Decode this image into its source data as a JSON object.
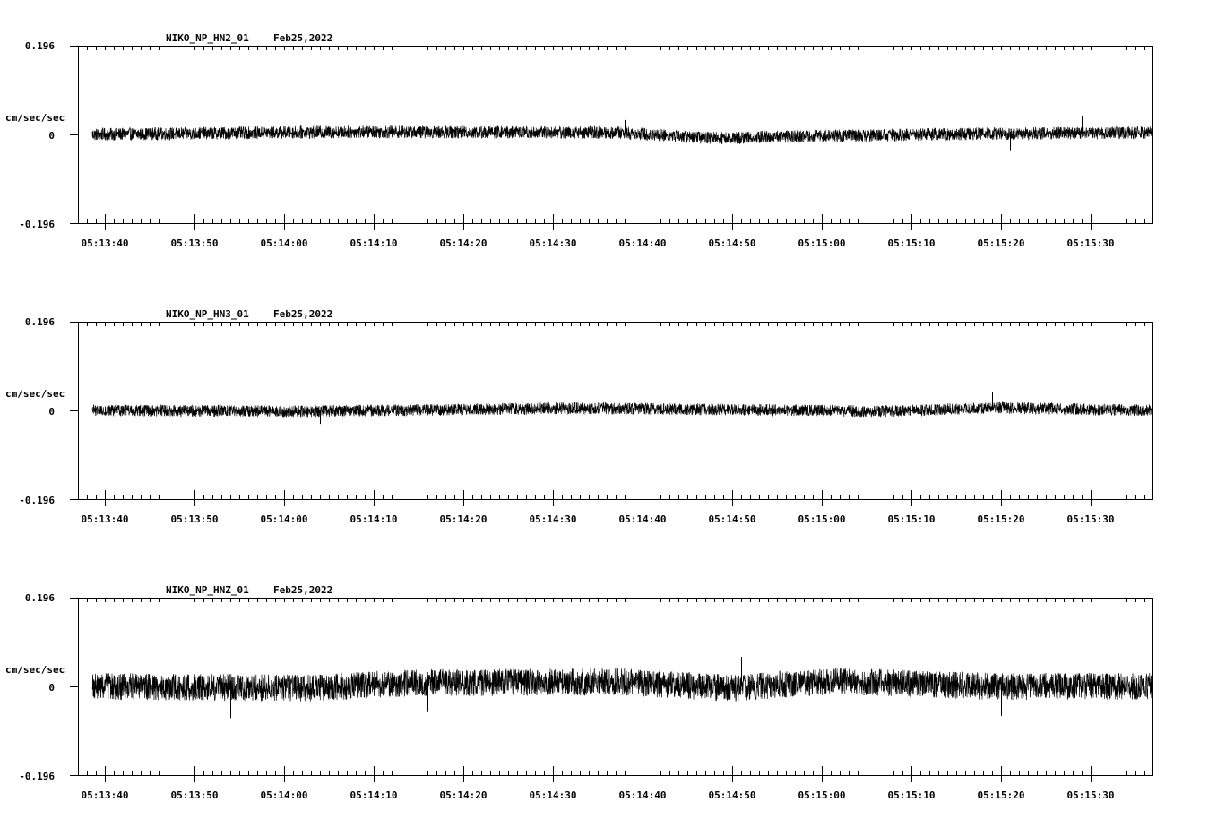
{
  "chart_data": [
    {
      "type": "line",
      "title": "NIKO_NP_HN2_01",
      "date": "Feb25,2022",
      "ylabel": "cm/sec/sec",
      "ylim": [
        -0.196,
        0.196
      ],
      "ytick_labels": [
        "0.196",
        "0",
        "-0.196"
      ],
      "xtick_labels": [
        "05:13:40",
        "05:13:50",
        "05:14:00",
        "05:14:10",
        "05:14:20",
        "05:14:30",
        "05:14:40",
        "05:14:50",
        "05:15:00",
        "05:15:10",
        "05:15:20",
        "05:15:30"
      ],
      "noise_amplitude": 0.014,
      "spikes": [
        {
          "x": "05:14:38",
          "y": 0.032
        },
        {
          "x": "05:15:29",
          "y": 0.04
        },
        {
          "x": "05:15:21",
          "y": -0.035
        }
      ],
      "baseline_drift": [
        [
          0,
          0.0
        ],
        [
          0.25,
          0.006
        ],
        [
          0.5,
          0.004
        ],
        [
          0.58,
          -0.008
        ],
        [
          0.7,
          -0.003
        ],
        [
          0.85,
          0.002
        ],
        [
          1.0,
          0.004
        ]
      ]
    },
    {
      "type": "line",
      "title": "NIKO_NP_HN3_01",
      "date": "Feb25,2022",
      "ylabel": "cm/sec/sec",
      "ylim": [
        -0.196,
        0.196
      ],
      "ytick_labels": [
        "0.196",
        "0",
        "-0.196"
      ],
      "xtick_labels": [
        "05:13:40",
        "05:13:50",
        "05:14:00",
        "05:14:10",
        "05:14:20",
        "05:14:30",
        "05:14:40",
        "05:14:50",
        "05:15:00",
        "05:15:10",
        "05:15:20",
        "05:15:30"
      ],
      "noise_amplitude": 0.013,
      "spikes": [
        {
          "x": "05:15:19",
          "y": 0.04
        },
        {
          "x": "05:14:04",
          "y": -0.03
        }
      ],
      "baseline_drift": [
        [
          0,
          0.0
        ],
        [
          0.2,
          -0.002
        ],
        [
          0.45,
          0.005
        ],
        [
          0.6,
          0.002
        ],
        [
          0.75,
          -0.002
        ],
        [
          0.85,
          0.006
        ],
        [
          1.0,
          0.0
        ]
      ]
    },
    {
      "type": "line",
      "title": "NIKO_NP_HNZ_01",
      "date": "Feb25,2022",
      "ylabel": "cm/sec/sec",
      "ylim": [
        -0.196,
        0.196
      ],
      "ytick_labels": [
        "0.196",
        "0",
        "-0.196"
      ],
      "xtick_labels": [
        "05:13:40",
        "05:13:50",
        "05:14:00",
        "05:14:10",
        "05:14:20",
        "05:14:30",
        "05:14:40",
        "05:14:50",
        "05:15:00",
        "05:15:10",
        "05:15:20",
        "05:15:30"
      ],
      "noise_amplitude": 0.03,
      "spikes": [
        {
          "x": "05:13:54",
          "y": -0.07
        },
        {
          "x": "05:14:16",
          "y": -0.055
        },
        {
          "x": "05:14:51",
          "y": 0.065
        },
        {
          "x": "05:15:20",
          "y": -0.065
        }
      ],
      "baseline_drift": [
        [
          0,
          0.0
        ],
        [
          0.2,
          -0.004
        ],
        [
          0.3,
          0.008
        ],
        [
          0.5,
          0.01
        ],
        [
          0.6,
          -0.004
        ],
        [
          0.7,
          0.012
        ],
        [
          0.85,
          0.0
        ],
        [
          1.0,
          0.0
        ]
      ]
    }
  ]
}
